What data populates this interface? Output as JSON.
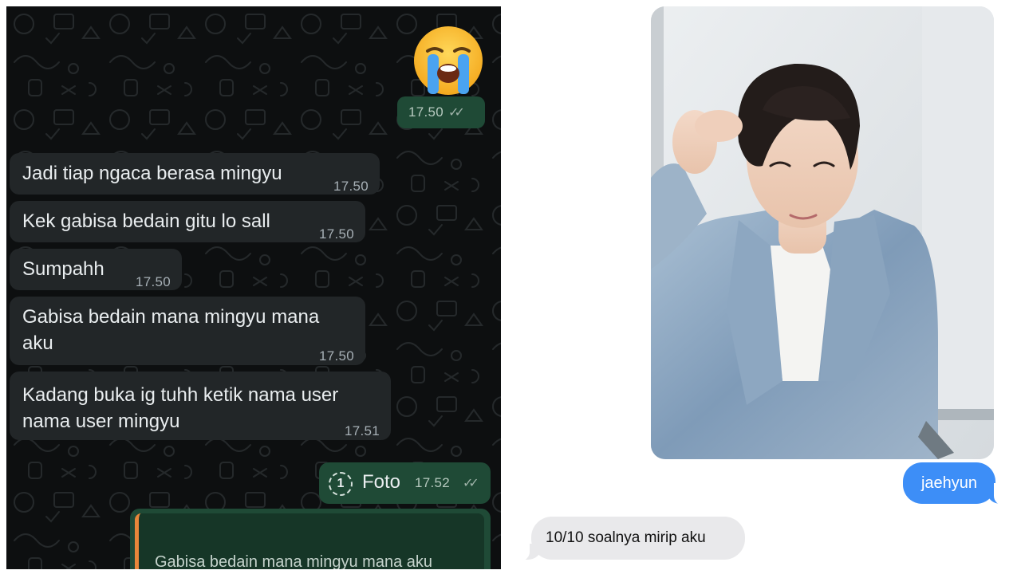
{
  "whatsapp": {
    "sent_emoji": {
      "icon": "loudly-crying-face-icon",
      "time": "17.50"
    },
    "messages": [
      {
        "text": "Jadi tiap ngaca berasa mingyu",
        "time": "17.50"
      },
      {
        "text": "Kek gabisa bedain gitu lo sall",
        "time": "17.50"
      },
      {
        "text": "Sumpahh",
        "time": "17.50"
      },
      {
        "line1": "Gabisa bedain mana mingyu mana",
        "line2": "aku",
        "time": "17.50"
      },
      {
        "line1": "Kadang buka ig tuhh ketik nama user",
        "line2": "nama user mingyu",
        "time": "17.51"
      }
    ],
    "photo_message": {
      "icon": "view-once-icon",
      "icon_text": "1",
      "label": "Foto",
      "time": "17.52"
    },
    "reply_quote": {
      "text": "Gabisa bedain mana mingyu mana aku"
    },
    "colors": {
      "background": "#0d0f10",
      "incoming_bubble": "#222628",
      "outgoing_bubble": "#1f4a36",
      "quote_accent": "#e8863a"
    }
  },
  "imessage": {
    "photo": {
      "icon": "photo-attachment"
    },
    "sent_message": {
      "text": "jaehyun"
    },
    "received_message": {
      "text": "10/10 soalnya mirip aku"
    },
    "colors": {
      "sent_bubble": "#3d8ef7",
      "received_bubble": "#e9e9eb"
    }
  }
}
